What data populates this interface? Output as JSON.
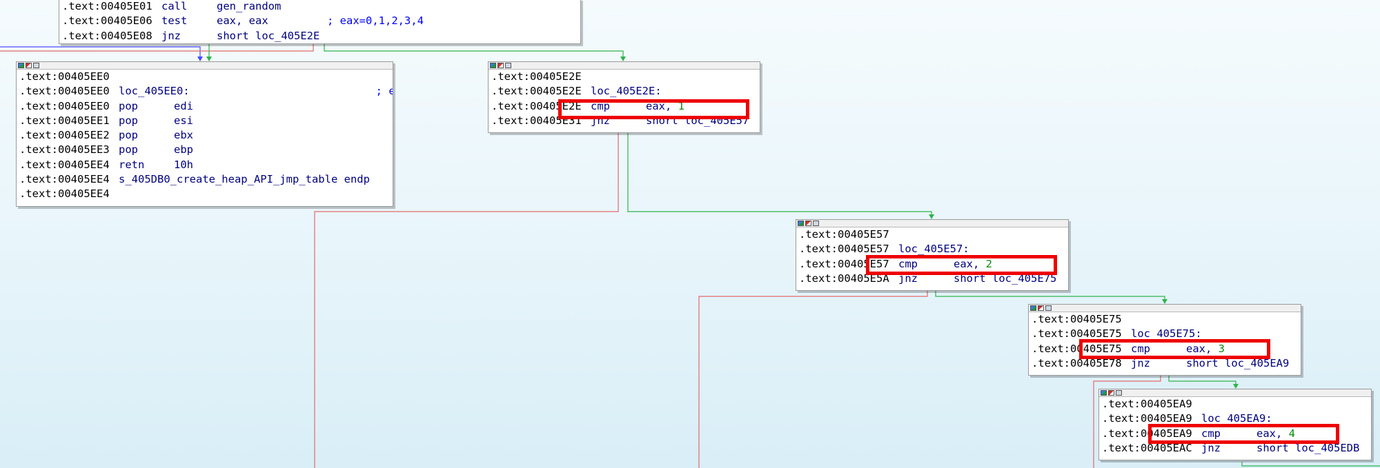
{
  "colors": {
    "true_edge": "#2fb34d",
    "false_edge": "#e36a6a",
    "jump_edge": "#4a4aff",
    "highlight": "#ee0000"
  },
  "nodes": {
    "top": {
      "lines": [
        {
          "addr": ".text:00405E01",
          "mn": "call",
          "op": "gen_random",
          "cmt": ""
        },
        {
          "addr": ".text:00405E06",
          "mn": "test",
          "op": "eax, eax",
          "cmt": "; eax=0,1,2,3,4"
        },
        {
          "addr": ".text:00405E08",
          "mn": "jnz",
          "op": "short loc_405E2E",
          "cmt": ""
        }
      ]
    },
    "exit": {
      "lines": [
        {
          "addr": ".text:00405EE0",
          "mn": "",
          "op": "",
          "cmt": ""
        },
        {
          "addr": ".text:00405EE0",
          "mn": "loc_405EE0:",
          "op": "",
          "cmt": "; eax=CCCCCCCC"
        },
        {
          "addr": ".text:00405EE0",
          "mn": "pop",
          "op": "edi",
          "cmt": ""
        },
        {
          "addr": ".text:00405EE1",
          "mn": "pop",
          "op": "esi",
          "cmt": ""
        },
        {
          "addr": ".text:00405EE2",
          "mn": "pop",
          "op": "ebx",
          "cmt": ""
        },
        {
          "addr": ".text:00405EE3",
          "mn": "pop",
          "op": "ebp",
          "cmt": ""
        },
        {
          "addr": ".text:00405EE4",
          "mn": "retn",
          "op": "10h",
          "cmt": ""
        },
        {
          "addr": ".text:00405EE4",
          "mn": "s_405DB0_create_heap_API_jmp_table endp",
          "op": "",
          "cmt": ""
        },
        {
          "addr": ".text:00405EE4",
          "mn": "",
          "op": "",
          "cmt": ""
        }
      ]
    },
    "n1": {
      "lines": [
        {
          "addr": ".text:00405E2E",
          "mn": "",
          "op": "",
          "cmt": ""
        },
        {
          "addr": ".text:00405E2E",
          "mn": "loc_405E2E:",
          "op": "",
          "cmt": ""
        },
        {
          "addr": ".text:00405E2E",
          "mn": "cmp",
          "op": "eax, ",
          "num": "1",
          "cmt": ""
        },
        {
          "addr": ".text:00405E31",
          "mn": "jnz",
          "op": "short loc_405E57",
          "cmt": ""
        }
      ]
    },
    "n2": {
      "lines": [
        {
          "addr": ".text:00405E57",
          "mn": "",
          "op": "",
          "cmt": ""
        },
        {
          "addr": ".text:00405E57",
          "mn": "loc_405E57:",
          "op": "",
          "cmt": ""
        },
        {
          "addr": ".text:00405E57",
          "mn": "cmp",
          "op": "eax, ",
          "num": "2",
          "cmt": ""
        },
        {
          "addr": ".text:00405E5A",
          "mn": "jnz",
          "op": "short loc_405E75",
          "cmt": ""
        }
      ]
    },
    "n3": {
      "lines": [
        {
          "addr": ".text:00405E75",
          "mn": "",
          "op": "",
          "cmt": ""
        },
        {
          "addr": ".text:00405E75",
          "mn": "loc_405E75:",
          "op": "",
          "cmt": ""
        },
        {
          "addr": ".text:00405E75",
          "mn": "cmp",
          "op": "eax, ",
          "num": "3",
          "cmt": ""
        },
        {
          "addr": ".text:00405E78",
          "mn": "jnz",
          "op": "short loc_405EA9",
          "cmt": ""
        }
      ]
    },
    "n4": {
      "lines": [
        {
          "addr": ".text:00405EA9",
          "mn": "",
          "op": "",
          "cmt": ""
        },
        {
          "addr": ".text:00405EA9",
          "mn": "loc_405EA9:",
          "op": "",
          "cmt": ""
        },
        {
          "addr": ".text:00405EA9",
          "mn": "cmp",
          "op": "eax, ",
          "num": "4",
          "cmt": ""
        },
        {
          "addr": ".text:00405EAC",
          "mn": "jnz",
          "op": "short loc_405EDB",
          "cmt": ""
        }
      ]
    }
  }
}
